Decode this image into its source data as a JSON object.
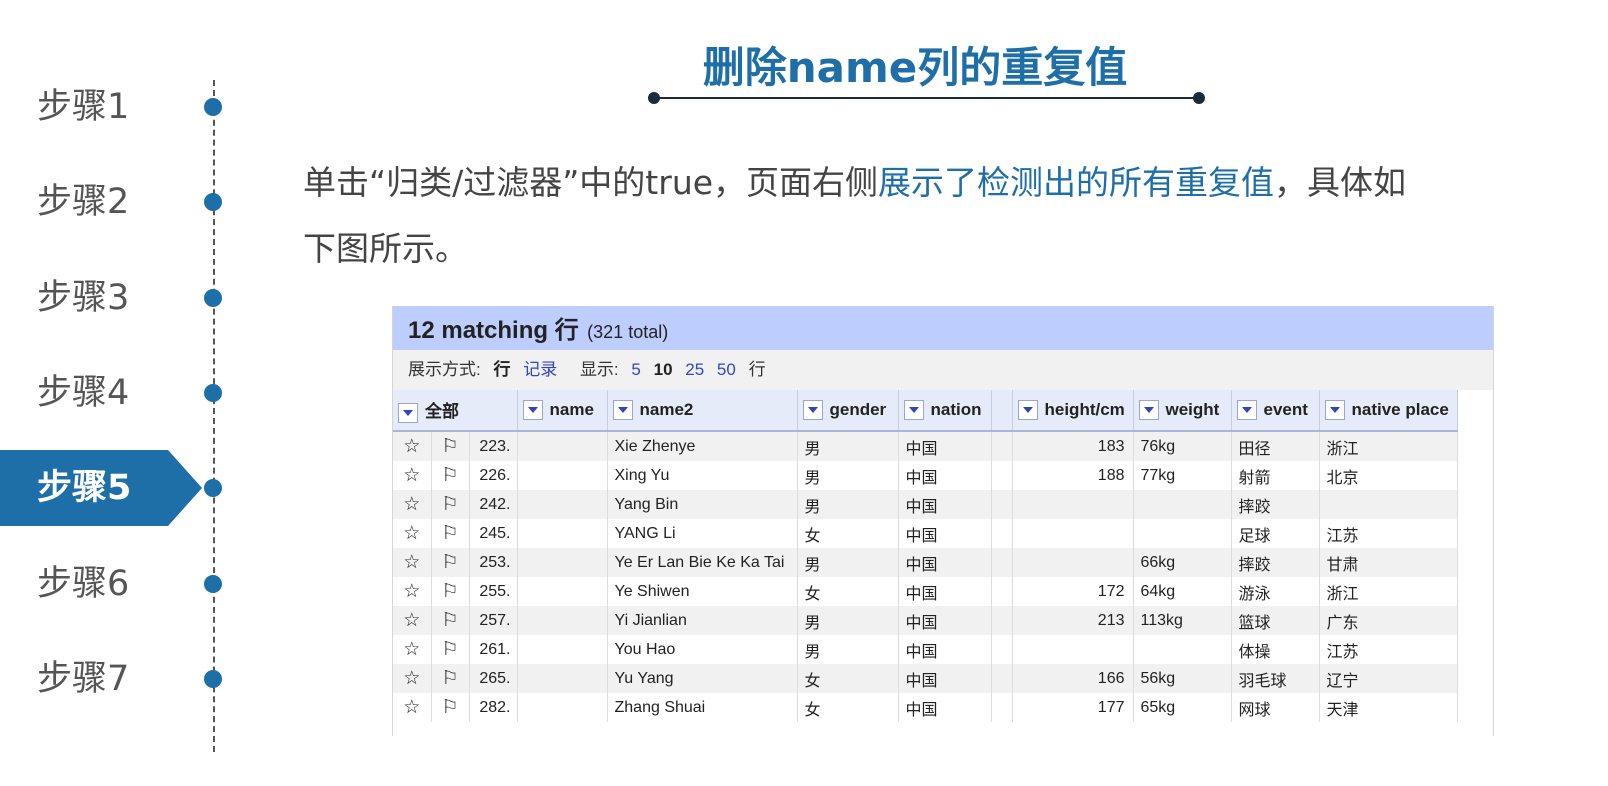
{
  "steps": [
    {
      "label": "步骤1"
    },
    {
      "label": "步骤2"
    },
    {
      "label": "步骤3"
    },
    {
      "label": "步骤4"
    },
    {
      "label": "步骤5",
      "active": true
    },
    {
      "label": "步骤6"
    },
    {
      "label": "步骤7"
    }
  ],
  "title": "删除name列的重复值",
  "description": {
    "line1_a": "单击“归类/过滤器”中的true，页面右侧",
    "line1_highlight": "展示了检测出的所有重复值",
    "line1_b": "，具体如",
    "line2": "下图所示。"
  },
  "panel": {
    "count": "12 matching 行",
    "total": "(321 total)",
    "view_label": "展示方式:",
    "view_rows": "行",
    "view_records": "记录",
    "show_label": "显示:",
    "page_sizes": [
      "5",
      "10",
      "25",
      "50"
    ],
    "page_size_selected": "10",
    "show_unit": "行",
    "columns": [
      "全部",
      "name",
      "name2",
      "gender",
      "nation",
      "",
      "height/cm",
      "weight",
      "event",
      "native place"
    ],
    "rows": [
      {
        "idx": "223.",
        "name": "",
        "name2": "Xie Zhenye",
        "gender": "男",
        "nation": "中国",
        "height": "183",
        "weight": "76kg",
        "event": "田径",
        "place": "浙江"
      },
      {
        "idx": "226.",
        "name": "",
        "name2": "Xing Yu",
        "gender": "男",
        "nation": "中国",
        "height": "188",
        "weight": "77kg",
        "event": "射箭",
        "place": "北京"
      },
      {
        "idx": "242.",
        "name": "",
        "name2": "Yang Bin",
        "gender": "男",
        "nation": "中国",
        "height": "",
        "weight": "",
        "event": "摔跤",
        "place": ""
      },
      {
        "idx": "245.",
        "name": "",
        "name2": "YANG Li",
        "gender": "女",
        "nation": "中国",
        "height": "",
        "weight": "",
        "event": "足球",
        "place": "江苏"
      },
      {
        "idx": "253.",
        "name": "",
        "name2": "Ye Er Lan Bie Ke Ka Tai",
        "gender": "男",
        "nation": "中国",
        "height": "",
        "weight": "66kg",
        "event": "摔跤",
        "place": "甘肃"
      },
      {
        "idx": "255.",
        "name": "",
        "name2": "Ye Shiwen",
        "gender": "女",
        "nation": "中国",
        "height": "172",
        "weight": "64kg",
        "event": "游泳",
        "place": "浙江"
      },
      {
        "idx": "257.",
        "name": "",
        "name2": "Yi Jianlian",
        "gender": "男",
        "nation": "中国",
        "height": "213",
        "weight": "113kg",
        "event": "篮球",
        "place": "广东"
      },
      {
        "idx": "261.",
        "name": "",
        "name2": "You Hao",
        "gender": "男",
        "nation": "中国",
        "height": "",
        "weight": "",
        "event": "体操",
        "place": "江苏"
      },
      {
        "idx": "265.",
        "name": "",
        "name2": "Yu Yang",
        "gender": "女",
        "nation": "中国",
        "height": "166",
        "weight": "56kg",
        "event": "羽毛球",
        "place": "辽宁"
      },
      {
        "idx": "282.",
        "name": "",
        "name2": "Zhang Shuai",
        "gender": "女",
        "nation": "中国",
        "height": "177",
        "weight": "65kg",
        "event": "网球",
        "place": "天津"
      }
    ]
  },
  "colors": {
    "accent": "#1e6ea7",
    "panel_header": "#bdcdfd",
    "numeric": "#2e8b2e"
  }
}
